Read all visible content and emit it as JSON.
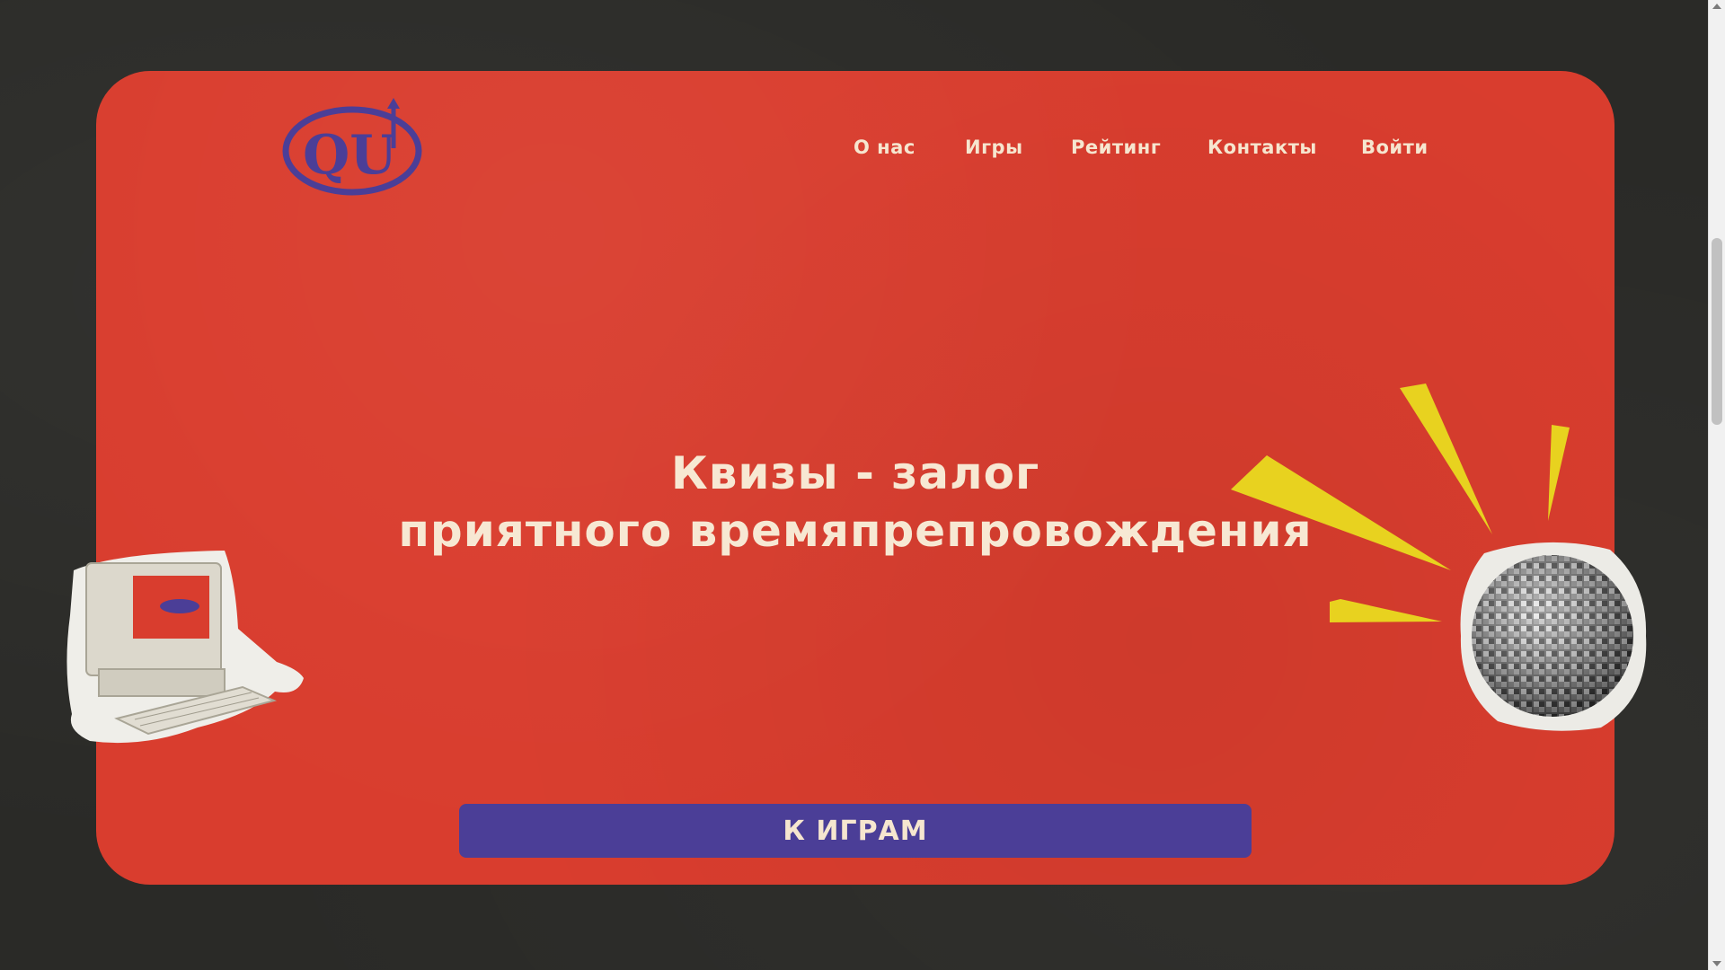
{
  "nav": {
    "items": [
      {
        "label": "О нас"
      },
      {
        "label": "Игры"
      },
      {
        "label": "Рейтинг"
      },
      {
        "label": "Контакты"
      },
      {
        "label": "Войти"
      }
    ]
  },
  "hero": {
    "headline_line1": "Квизы - залог",
    "headline_line2": "приятного времяпрепровождения",
    "cta_label": "К ИГРАМ"
  },
  "logo": {
    "text": "QU"
  },
  "colors": {
    "background": "#2a2a27",
    "hero_red": "#d93d2e",
    "accent_purple": "#4b3e97",
    "text_cream": "#f6e6cf",
    "ray_yellow": "#e8d21f"
  },
  "icons": {
    "computer": "retro-computer-illustration",
    "disco_ball": "disco-ball-illustration",
    "rays": "yellow-burst-rays"
  }
}
